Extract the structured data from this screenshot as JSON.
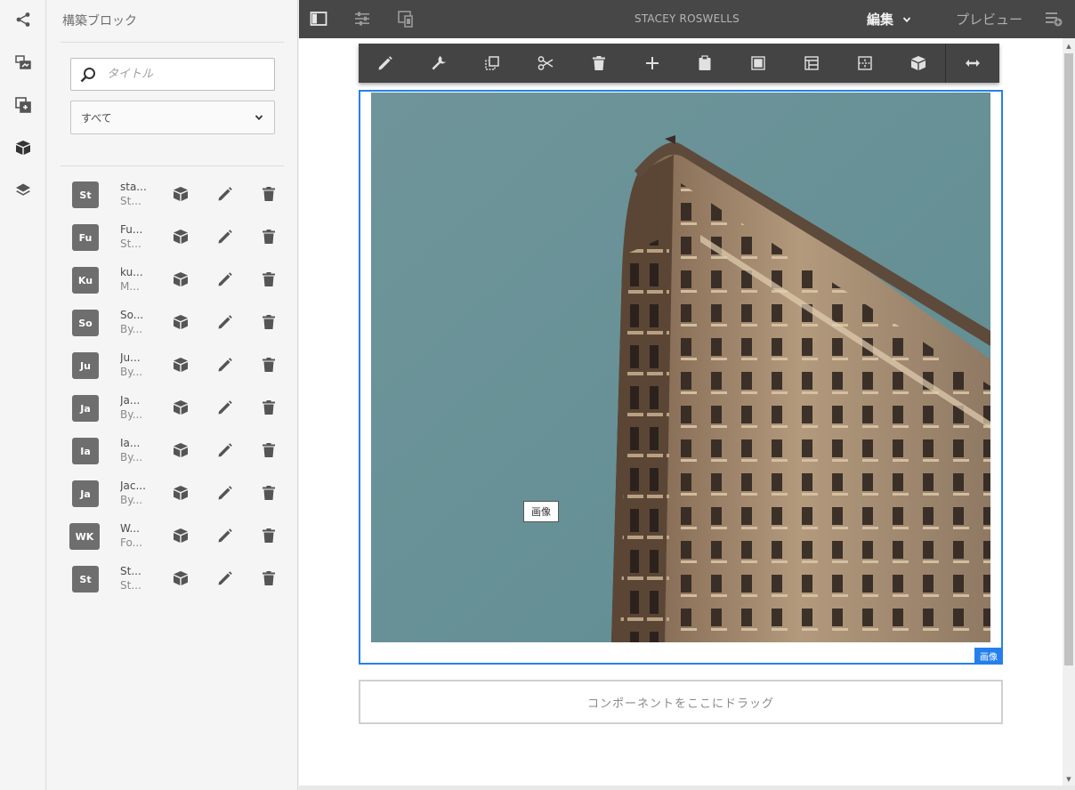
{
  "colors": {
    "accent": "#2680eb",
    "topbar": "#474747",
    "toolbar": "#444444",
    "badge": "#6e6e6e"
  },
  "rail": {
    "items": [
      {
        "icon": "share-icon"
      },
      {
        "icon": "assets-icon"
      },
      {
        "icon": "components-icon"
      },
      {
        "icon": "building-blocks-icon"
      },
      {
        "icon": "layers-icon"
      }
    ]
  },
  "panel": {
    "title": "構築ブロック",
    "search_placeholder": "タイトル",
    "filter_value": "すべて",
    "components": [
      {
        "badge": "St",
        "name": "sta...",
        "sub": "St..."
      },
      {
        "badge": "Fu",
        "name": "Fu...",
        "sub": "St..."
      },
      {
        "badge": "Ku",
        "name": "ku...",
        "sub": "M..."
      },
      {
        "badge": "So",
        "name": "So...",
        "sub": "By..."
      },
      {
        "badge": "Ju",
        "name": "Ju...",
        "sub": "By..."
      },
      {
        "badge": "Ja",
        "name": "Ja...",
        "sub": "By..."
      },
      {
        "badge": "Ia",
        "name": "Ia...",
        "sub": "By..."
      },
      {
        "badge": "Ja",
        "name": "Jac...",
        "sub": "By..."
      },
      {
        "badge": "WK",
        "name": "W...",
        "sub": "Fo..."
      },
      {
        "badge": "St",
        "name": "St...",
        "sub": "St..."
      }
    ]
  },
  "topbar": {
    "page_name": "STACEY ROSWELLS",
    "mode_label": "編集",
    "preview_label": "プレビュー"
  },
  "component_toolbar": {
    "actions": [
      "edit",
      "configure",
      "copy",
      "cut",
      "delete",
      "insert",
      "paste",
      "group",
      "parent",
      "layout",
      "convert-to-block",
      "expand"
    ]
  },
  "editor": {
    "image_placeholder_label": "画像",
    "frame_tag": "画像",
    "drop_zone_text": "コンポーネントをここにドラッグ"
  }
}
